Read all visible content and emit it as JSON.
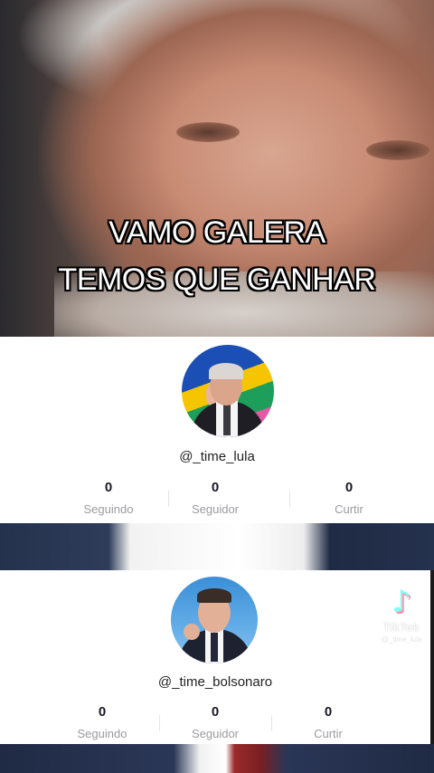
{
  "caption": {
    "line1": "VAMO GALERA",
    "line2": "TEMOS QUE GANHAR"
  },
  "profiles": [
    {
      "username": "@_time_lula",
      "stats": [
        {
          "value": "0",
          "label": "Seguindo"
        },
        {
          "value": "0",
          "label": "Seguidor"
        },
        {
          "value": "0",
          "label": "Curtir"
        }
      ]
    },
    {
      "username": "@_time_bolsonaro",
      "stats": [
        {
          "value": "0",
          "label": "Seguindo"
        },
        {
          "value": "0",
          "label": "Seguidor"
        },
        {
          "value": "0",
          "label": "Curtir"
        }
      ]
    }
  ],
  "watermark": {
    "icon": "tiktok-icon",
    "brand": "TikTok",
    "handle": "@_time_lula"
  },
  "colors": {
    "card_background": "#ffffff",
    "stat_number": "#161823",
    "stat_label": "#9b9ba0",
    "caption_text": "#ffffff",
    "caption_outline": "#000000"
  }
}
